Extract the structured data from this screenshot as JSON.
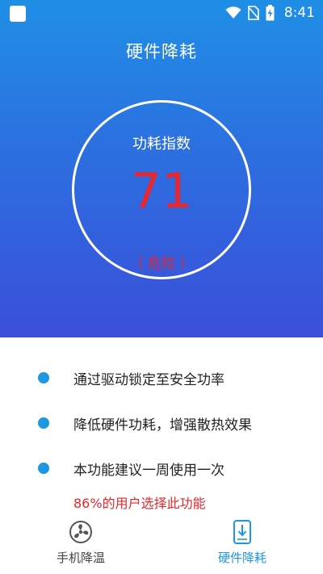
{
  "status_bar": {
    "time": "8:41"
  },
  "header": {
    "title": "硬件降耗"
  },
  "gauge": {
    "label": "功耗指数",
    "value": "71",
    "status": "（ 危险 ）"
  },
  "features": [
    {
      "text": "通过驱动锁定至安全功率"
    },
    {
      "text": "降低硬件功耗，增强散热效果"
    },
    {
      "text": "本功能建议一周使用一次"
    }
  ],
  "promo": "86%的用户选择此功能",
  "bottom_nav": {
    "items": [
      {
        "label": "手机降温",
        "icon": "fan-icon",
        "active": false
      },
      {
        "label": "硬件降耗",
        "icon": "phone-download-icon",
        "active": true
      }
    ]
  },
  "colors": {
    "accent": "#1e97e3",
    "danger": "#e8262b",
    "gradient_top": "#1f8fe6",
    "gradient_bottom": "#3b4fd9"
  }
}
